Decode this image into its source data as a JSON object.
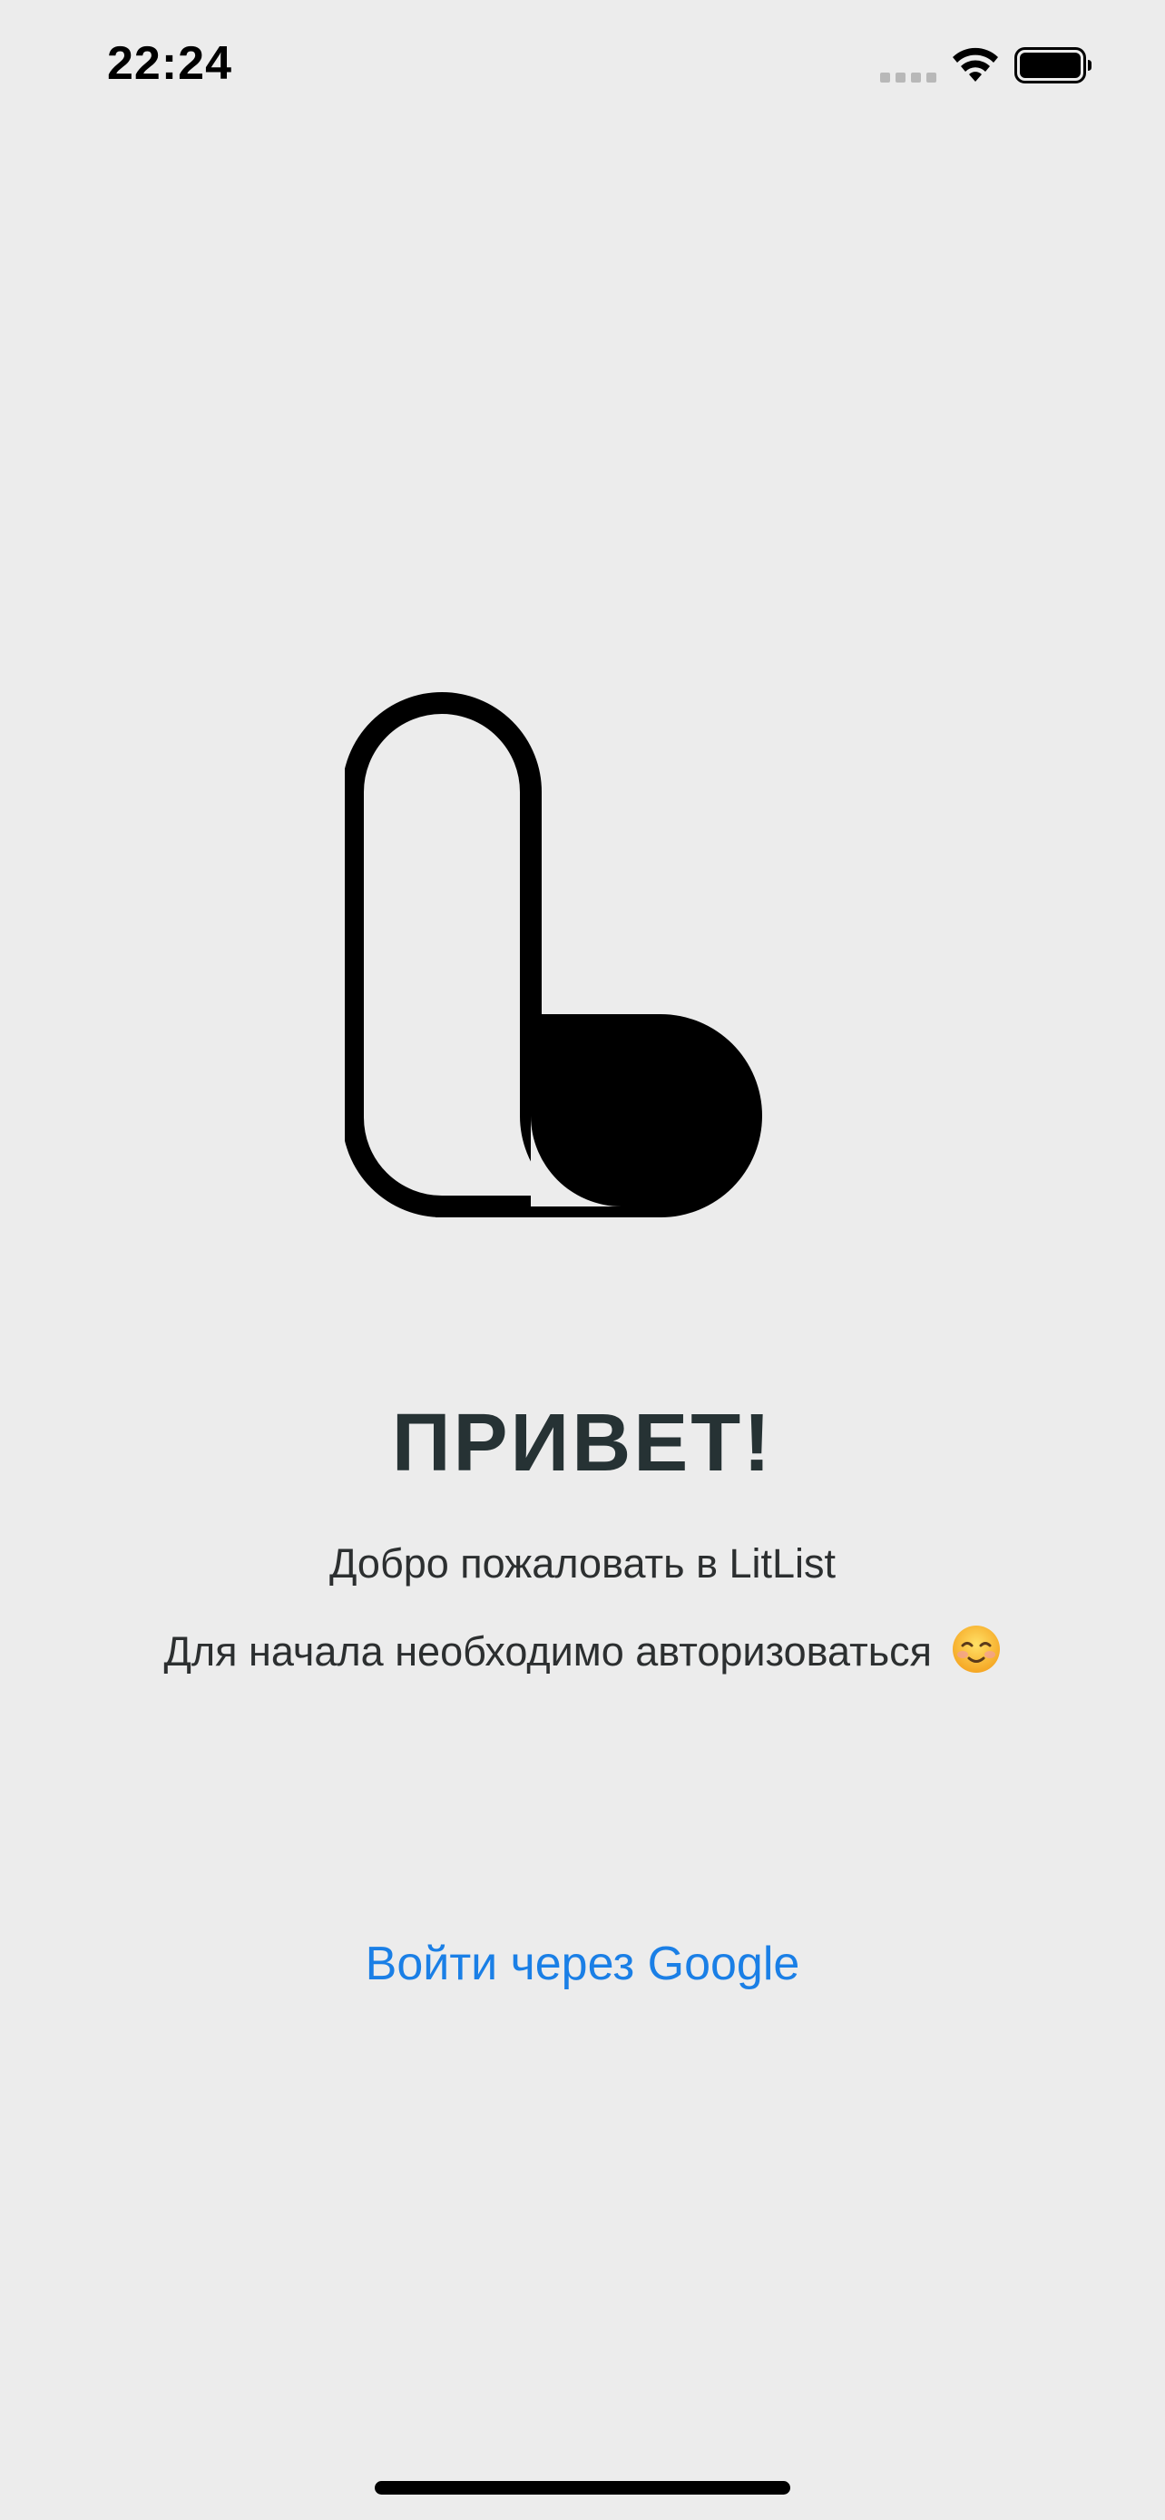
{
  "status_bar": {
    "time": "22:24",
    "icons": [
      "signal-icon",
      "wifi-icon",
      "battery-icon"
    ]
  },
  "logo": {
    "icon": "litlist-logo-icon"
  },
  "greeting": {
    "title": "ПРИВЕТ!",
    "welcome": "Добро пожаловать в LitList",
    "auth_prompt": "Для начала необходимо авторизоваться",
    "emoji": "smiling-face-icon"
  },
  "login": {
    "google_button_label": "Войти через Google"
  },
  "colors": {
    "background": "#ececec",
    "title": "#263234",
    "body_text": "#2c2f30",
    "link": "#1a7fe6"
  }
}
